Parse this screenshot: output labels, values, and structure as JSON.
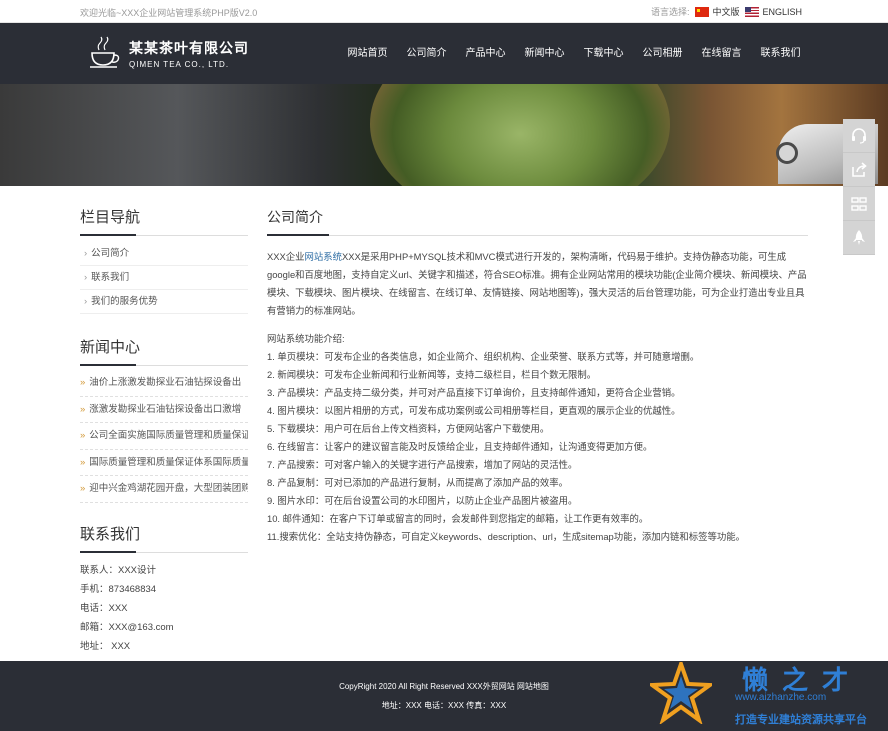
{
  "topbar": {
    "welcome": "欢迎光临~XXX企业网站管理系统PHP版V2.0",
    "lang_label": "语言选择:",
    "lang_cn": "中文版",
    "lang_en": "ENGLISH"
  },
  "logo": {
    "cn": "某某茶叶有限公司",
    "en": "QIMEN TEA CO., LTD."
  },
  "nav": [
    "网站首页",
    "公司简介",
    "产品中心",
    "新闻中心",
    "下载中心",
    "公司相册",
    "在线留言",
    "联系我们"
  ],
  "sidebar": {
    "menu_title": "栏目导航",
    "menu": [
      "公司简介",
      "联系我们",
      "我们的服务优势"
    ],
    "news_title": "新闻中心",
    "news": [
      "油价上涨激发勘探业石油钻探设备出",
      "涨激发勘探业石油钻探设备出口激增",
      "公司全面实施国际质量管理和质量保证",
      "国际质量管理和质量保证体系国际质量",
      "迎中兴金鸡湖花园开盘，大型团装团购"
    ],
    "contact_title": "联系我们",
    "contact": [
      "联系人：XXX设计",
      "手机：873468834",
      "电话：XXX",
      "邮箱：XXX@163.com",
      "地址： XXX"
    ]
  },
  "content": {
    "title": "公司简介",
    "intro_prefix": "XXX企业",
    "intro_link": "网站系统",
    "intro_rest": "XXX是采用PHP+MYSQL技术和MVC模式进行开发的，架构清晰，代码易于维护。支持伪静态功能，可生成google和百度地图，支持自定义url、关键字和描述，符合SEO标准。拥有企业网站常用的模块功能(企业简介模块、新闻模块、产品模块、下载模块、图片模块、在线留言、在线订单、友情链接、网站地图等)，强大灵活的后台管理功能，可为企业打造出专业且具有营销力的标准网站。",
    "features_head": "网站系统功能介绍:",
    "features": [
      "1. 单页模块：可发布企业的各类信息，如企业简介、组织机构、企业荣誉、联系方式等，并可随意增删。",
      "2. 新闻模块：可发布企业新闻和行业新闻等，支持二级栏目，栏目个数无限制。",
      "3. 产品模块：产品支持二级分类，并可对产品直接下订单询价，且支持邮件通知，更符合企业营销。",
      "4. 图片模块：以图片相册的方式，可发布成功案例或公司相册等栏目，更直观的展示企业的优越性。",
      "5. 下载模块：用户可在后台上传文档资料，方便网站客户下载使用。",
      "6. 在线留言：让客户的建议留言能及时反馈给企业，且支持邮件通知，让沟通变得更加方便。",
      "7. 产品搜索：可对客户输入的关键字进行产品搜索，增加了网站的灵活性。",
      "8. 产品复制：可对已添加的产品进行复制，从而提高了添加产品的效率。",
      "9. 图片水印：可在后台设置公司的水印图片，以防止企业产品图片被盗用。",
      "10. 邮件通知：在客户下订单或留言的同时，会发邮件到您指定的邮箱，让工作更有效率的。",
      "11.搜索优化：全站支持伪静态，可自定义keywords、description、url，生成sitemap功能，添加内链和标签等功能。"
    ]
  },
  "footer": {
    "copyright": "CopyRight 2020 All Right Reserved XXX外贸网站  网站地图",
    "address": "地址：XXX  电话：XXX  传真：XXX"
  },
  "watermark": {
    "brand": "懒之才",
    "url": "www.aizhanzhe.com",
    "slogan": "打造专业建站资源共享平台"
  },
  "float_tools": [
    "headset-icon",
    "share-icon",
    "qrcode-icon",
    "rocket-icon"
  ]
}
